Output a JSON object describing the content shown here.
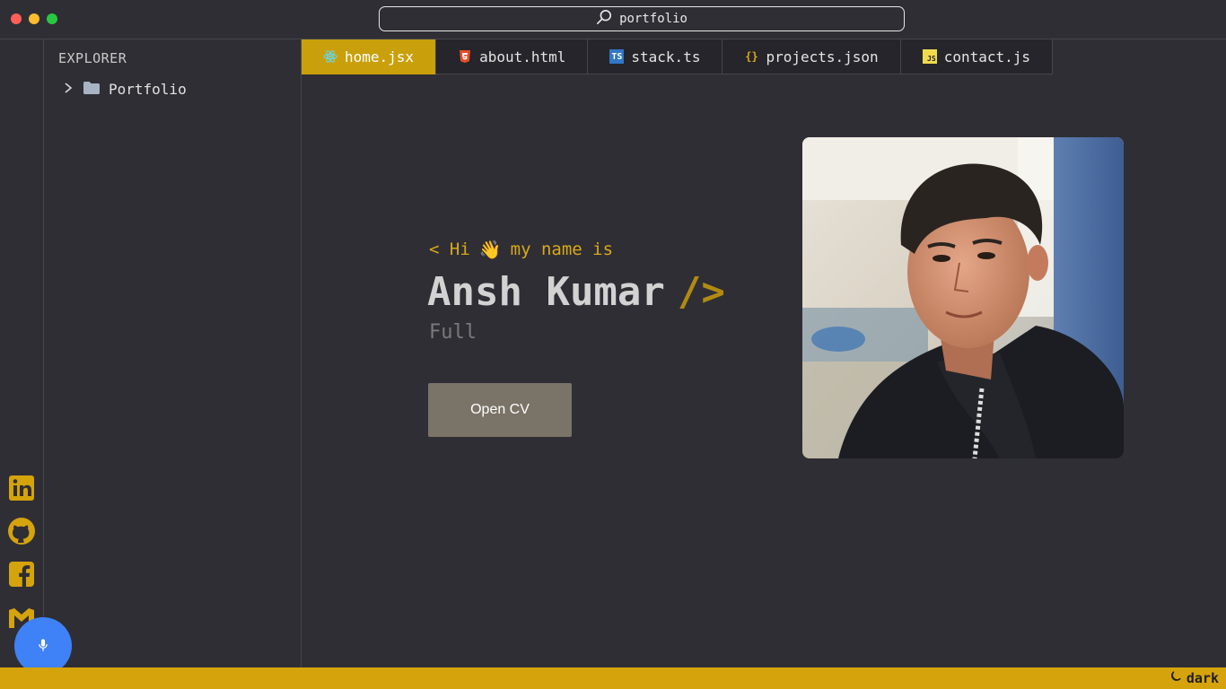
{
  "window": {
    "search_text": "portfolio"
  },
  "explorer": {
    "title": "EXPLORER",
    "root_folder": "Portfolio"
  },
  "tabs": [
    {
      "label": "home.jsx",
      "icon": "react-icon",
      "active": true
    },
    {
      "label": "about.html",
      "icon": "html5-icon",
      "active": false
    },
    {
      "label": "stack.ts",
      "icon": "typescript-icon",
      "active": false
    },
    {
      "label": "projects.json",
      "icon": "json-icon",
      "active": false
    },
    {
      "label": "contact.js",
      "icon": "javascript-icon",
      "active": false
    }
  ],
  "hero": {
    "greeting_prefix": "< Hi",
    "greeting_emoji": "👋",
    "greeting_suffix": "my name is",
    "name": "Ansh Kumar",
    "name_suffix": "/>",
    "role": "Full",
    "cv_button": "Open CV"
  },
  "social_links": [
    "linkedin-icon",
    "github-icon",
    "facebook-icon",
    "gmail-icon"
  ],
  "status": {
    "theme_label": "dark"
  },
  "colors": {
    "accent": "#d5a30c",
    "background": "#2f2e35",
    "mic_button": "#3f82f7"
  }
}
